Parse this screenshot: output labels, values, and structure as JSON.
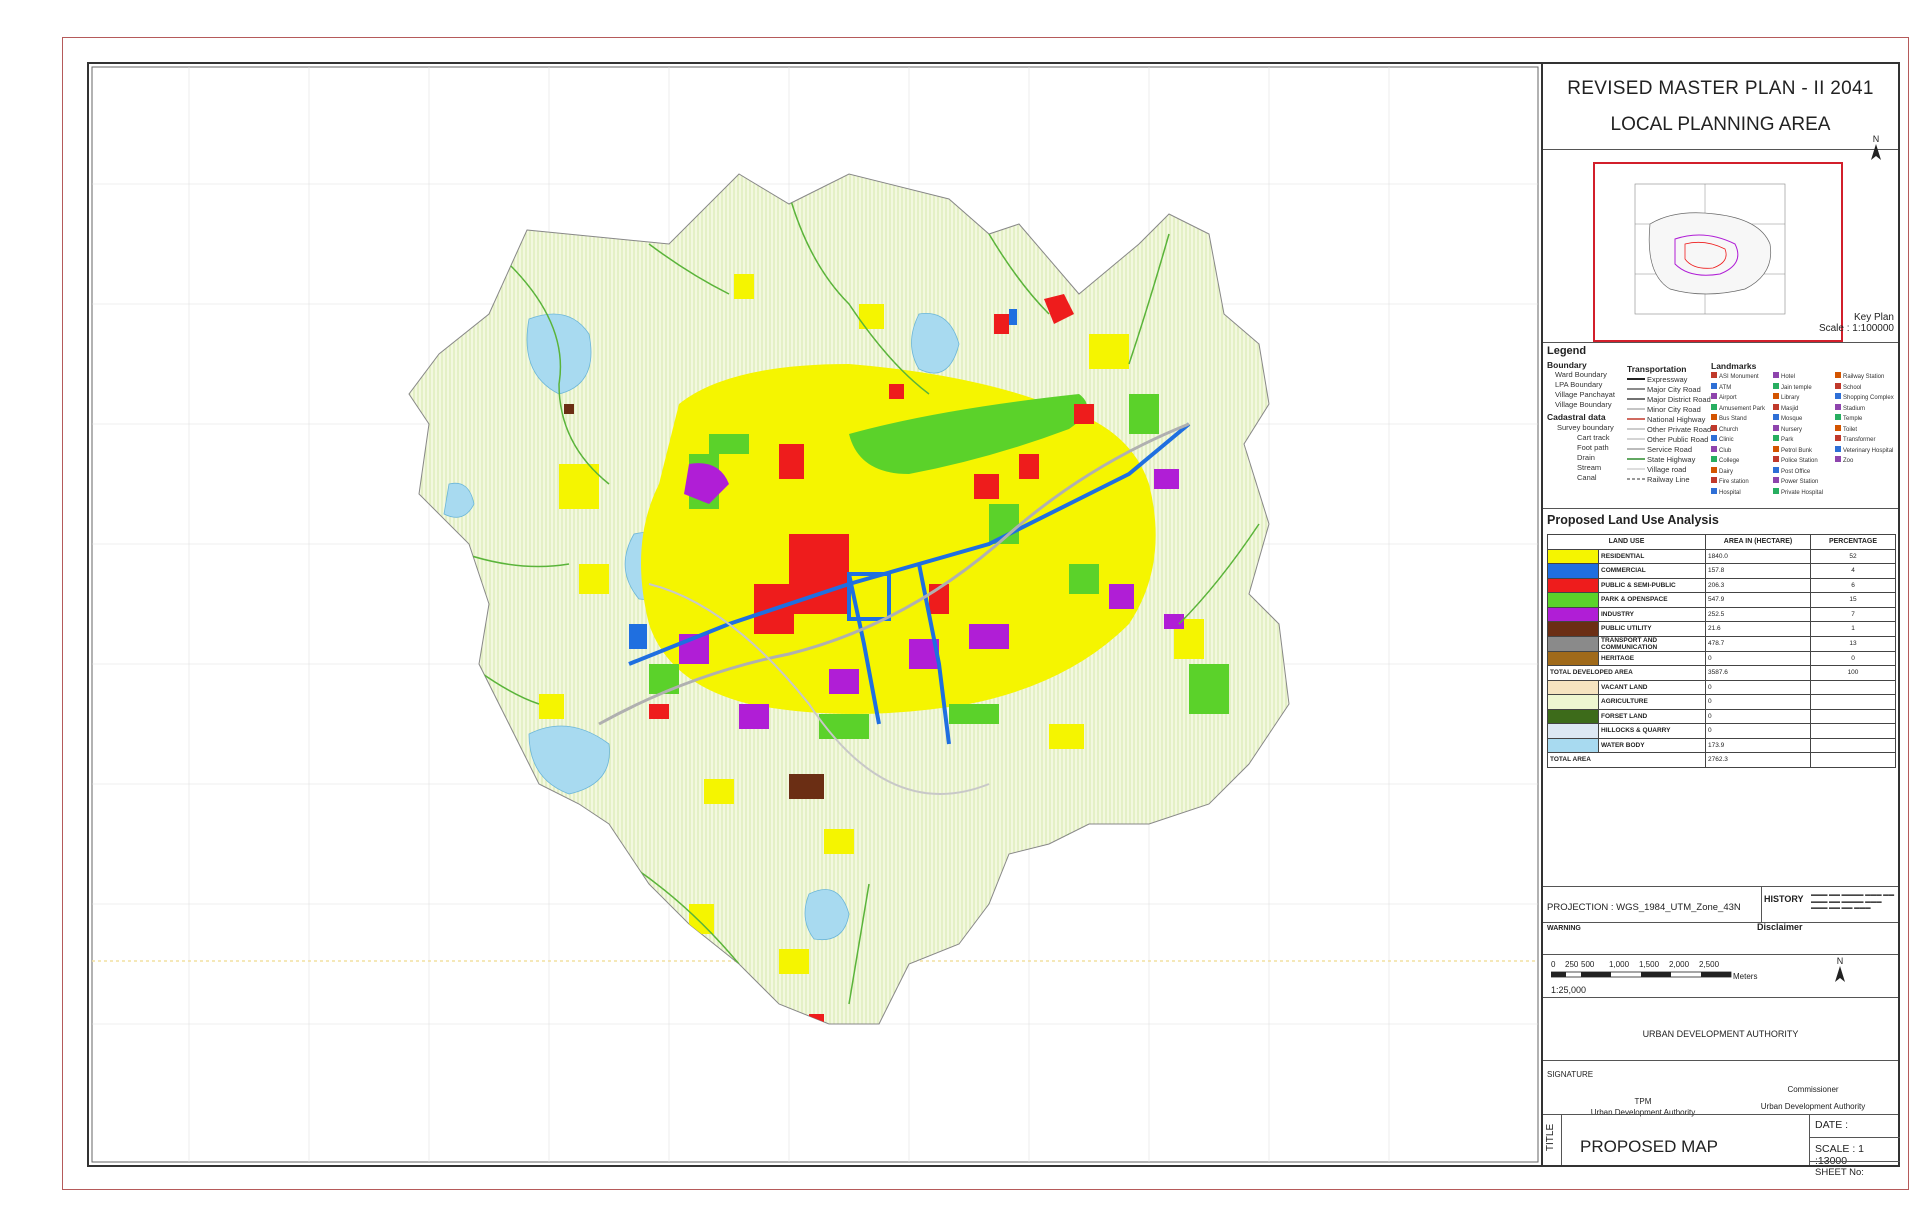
{
  "header": {
    "title": "REVISED MASTER PLAN - II 2041",
    "subtitle": "LOCAL PLANNING AREA"
  },
  "keyplan": {
    "north": "N",
    "label": "Key Plan",
    "scale": "Scale : 1:100000"
  },
  "legend": {
    "title": "Legend",
    "boundary": {
      "heading": "Boundary",
      "items": [
        "Ward Boundary",
        "LPA Boundary",
        "Village Panchayat",
        "Village Boundary"
      ]
    },
    "cadastral": {
      "heading": "Cadastral data",
      "items": [
        "Survey boundary",
        "Cart track",
        "Foot path",
        "Drain",
        "Stream",
        "Canal"
      ]
    },
    "transportation": {
      "heading": "Transportation",
      "items": [
        "Expressway",
        "Major City Road",
        "Major District Road",
        "Minor City Road",
        "National Highway",
        "Other Private Road",
        "Other Public Road",
        "Service Road",
        "State Highway",
        "Village road",
        "Railway Line"
      ]
    },
    "landmarks": {
      "heading": "Landmarks",
      "items": [
        "ASI Monument",
        "ATM",
        "Airport",
        "Amusement Park",
        "Bus Stand",
        "Church",
        "Clinic",
        "Club",
        "College",
        "Dairy",
        "Fire station",
        "Hospital",
        "Hotel",
        "Jain temple",
        "Library",
        "Masjid",
        "Mosque",
        "Nursery",
        "Park",
        "Petrol Bunk",
        "Police Station",
        "Post Office",
        "Power Station",
        "Private Hospital",
        "Railway Station",
        "School",
        "Shopping Complex",
        "Stadium",
        "Temple",
        "Toilet",
        "Transformer",
        "Veterinary Hospital",
        "Zoo"
      ]
    }
  },
  "land_use": {
    "title": "Proposed Land Use Analysis",
    "headers": [
      "LAND USE",
      "AREA IN (HECTARE)",
      "PERCENTAGE"
    ],
    "rows": [
      {
        "name": "RESIDENTIAL",
        "area": "1840.0",
        "pct": "52",
        "color": "#f5f500"
      },
      {
        "name": "COMMERCIAL",
        "area": "157.8",
        "pct": "4",
        "color": "#1f6fe0"
      },
      {
        "name": "PUBLIC & SEMI-PUBLIC",
        "area": "206.3",
        "pct": "6",
        "color": "#ee1c1c"
      },
      {
        "name": "PARK & OPENSPACE",
        "area": "547.9",
        "pct": "15",
        "color": "#5bd22a"
      },
      {
        "name": "INDUSTRY",
        "area": "252.5",
        "pct": "7",
        "color": "#b01ed6"
      },
      {
        "name": "PUBLIC UTILITY",
        "area": "21.6",
        "pct": "1",
        "color": "#6b2e14"
      },
      {
        "name": "TRANSPORT AND COMMUNICATION",
        "area": "478.7",
        "pct": "13",
        "color": "#8a8a8a"
      },
      {
        "name": "HERITAGE",
        "area": "0",
        "pct": "0",
        "color": "#a06a1a"
      }
    ],
    "total_developed": {
      "name": "TOTAL DEVELOPED AREA",
      "area": "3587.6",
      "pct": "100"
    },
    "other_rows": [
      {
        "name": "VACANT LAND",
        "area": "0",
        "pct": "",
        "color": "#f6e4c0"
      },
      {
        "name": "AGRICULTURE",
        "area": "0",
        "pct": "",
        "color": "#eef6d0"
      },
      {
        "name": "FORSET LAND",
        "area": "0",
        "pct": "",
        "color": "#3d6b1a"
      },
      {
        "name": "HILLOCKS & QUARRY",
        "area": "0",
        "pct": "",
        "color": "#dde8f3"
      },
      {
        "name": "WATER BODY",
        "area": "173.9",
        "pct": "",
        "color": "#a8daf0"
      }
    ],
    "total_area": {
      "name": "TOTAL AREA",
      "area": "2762.3"
    }
  },
  "projection": {
    "label": "PROJECTION : WGS_1984_UTM_Zone_43N",
    "history_label": "HISTORY",
    "disclaimer_label": "Disclaimer",
    "warning_label": "WARNING"
  },
  "scalebar": {
    "ticks": [
      "0",
      "250",
      "500",
      "1,000",
      "1,500",
      "2,000",
      "2,500"
    ],
    "unit": "Meters",
    "ratio": "1:25,000",
    "north": "N"
  },
  "authority": "URBAN DEVELOPMENT AUTHORITY",
  "signature": {
    "heading": "SIGNATURE",
    "left_title": "TPM",
    "left_org": "Urban Development Authority",
    "right_title": "Commissioner",
    "right_org": "Urban Development Authority"
  },
  "titleblock": {
    "vertical_label": "TITLE",
    "name": "PROPOSED MAP",
    "date": "DATE :",
    "scale": "SCALE : 1 :13000",
    "sheet": "SHEET No:"
  },
  "colors": {
    "residential": "#f5f500",
    "commercial": "#1f6fe0",
    "public": "#ee1c1c",
    "park": "#5bd22a",
    "industry": "#b01ed6",
    "utility": "#6b2e14",
    "transport": "#8a8a8a",
    "water": "#a8daf0",
    "agriculture": "#eef6d0",
    "frame": "#b55a5a",
    "keyplan_border": "#d21f2b"
  }
}
